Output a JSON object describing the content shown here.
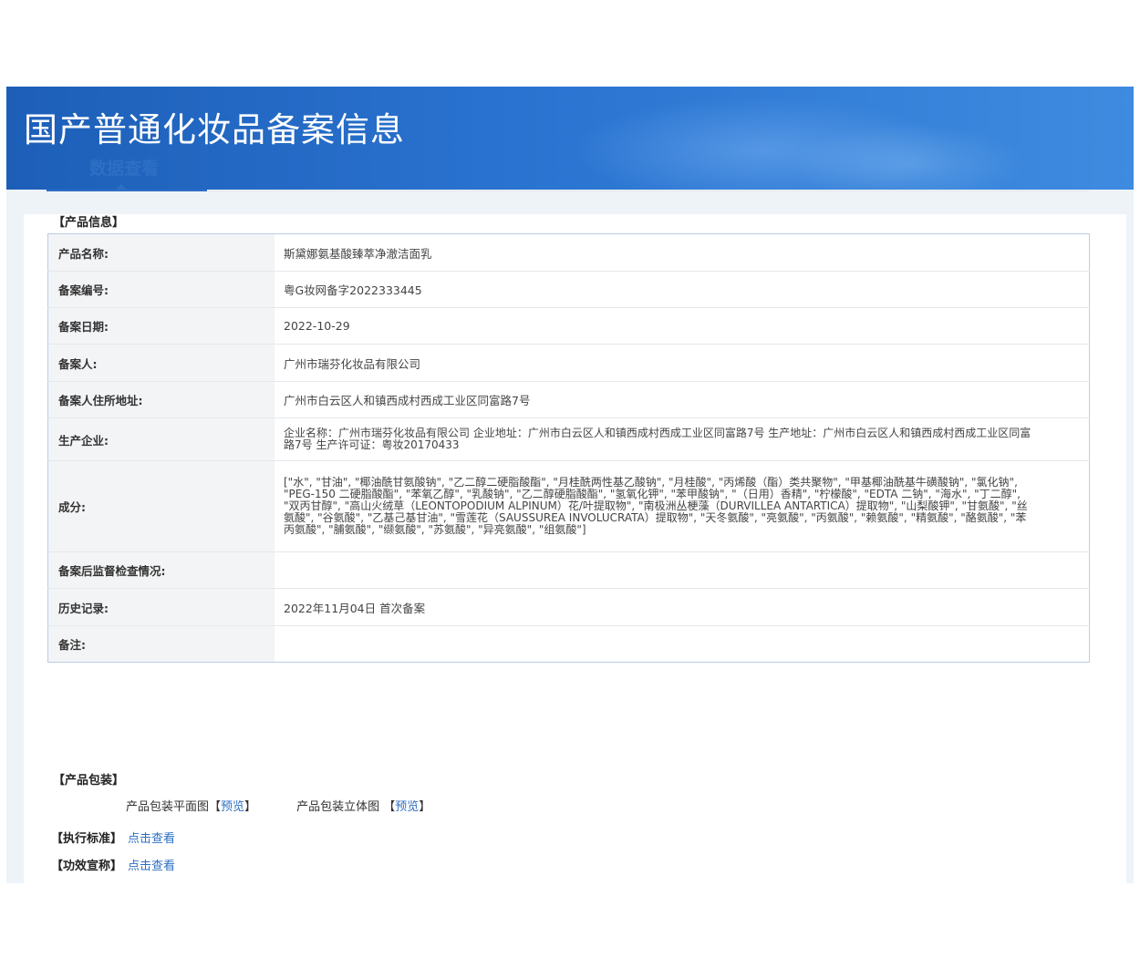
{
  "banner": {
    "title": "国产普通化妆品备案信息"
  },
  "tabs": {
    "active_label": "数据查看"
  },
  "product_info": {
    "section_title": "【产品信息】",
    "rows": [
      {
        "label": "产品名称:",
        "value": "斯黛娜氨基酸臻萃净澈洁面乳"
      },
      {
        "label": "备案编号:",
        "value": "粤G妆网备字2022333445"
      },
      {
        "label": "备案日期:",
        "value": "2022-10-29"
      },
      {
        "label": "备案人:",
        "value": "广州市瑞芬化妆品有限公司"
      },
      {
        "label": "备案人住所地址:",
        "value": "广州市白云区人和镇西成村西成工业区同富路7号"
      },
      {
        "label": "生产企业:",
        "value": "企业名称：广州市瑞芬化妆品有限公司 企业地址：广州市白云区人和镇西成村西成工业区同富路7号 生产地址：广州市白云区人和镇西成村西成工业区同富路7号 生产许可证：粤妆20170433"
      },
      {
        "label": "成分:",
        "value": "[\"水\", \"甘油\", \"椰油酰甘氨酸钠\", \"乙二醇二硬脂酸酯\", \"月桂酰两性基乙酸钠\", \"月桂酸\", \"丙烯酸（酯）类共聚物\", \"甲基椰油酰基牛磺酸钠\", \"氯化钠\", \"PEG-150 二硬脂酸酯\", \"苯氧乙醇\", \"乳酸钠\", \"乙二醇硬脂酸酯\", \"氢氧化钾\", \"苯甲酸钠\", \"（日用）香精\", \"柠檬酸\", \"EDTA 二钠\", \"海水\", \"丁二醇\", \"双丙甘醇\", \"高山火绒草（LEONTOPODIUM ALPINUM）花/叶提取物\", \"南极洲丛梗藻（DURVILLEA ANTARTICA）提取物\", \"山梨酸钾\", \"甘氨酸\", \"丝氨酸\", \"谷氨酸\", \"乙基己基甘油\", \"雪莲花（SAUSSUREA INVOLUCRATA）提取物\", \"天冬氨酸\", \"亮氨酸\", \"丙氨酸\", \"赖氨酸\", \"精氨酸\", \"酪氨酸\", \"苯丙氨酸\", \"脯氨酸\", \"缬氨酸\", \"苏氨酸\", \"异亮氨酸\", \"组氨酸\"]"
      },
      {
        "label": "备案后监督检查情况:",
        "value": ""
      },
      {
        "label": "历史记录:",
        "value": "2022年11月04日 首次备案"
      },
      {
        "label": "备注:",
        "value": ""
      }
    ]
  },
  "packaging": {
    "section_title": "【产品包装】",
    "flat_label": "产品包装平面图",
    "solid_label": "产品包装立体图",
    "bracket_open": "【",
    "bracket_close": "】",
    "preview_link": "预览"
  },
  "standard": {
    "label": "【执行标准】",
    "link": "点击查看"
  },
  "efficacy": {
    "label": "【功效宣称】",
    "link": "点击查看"
  }
}
